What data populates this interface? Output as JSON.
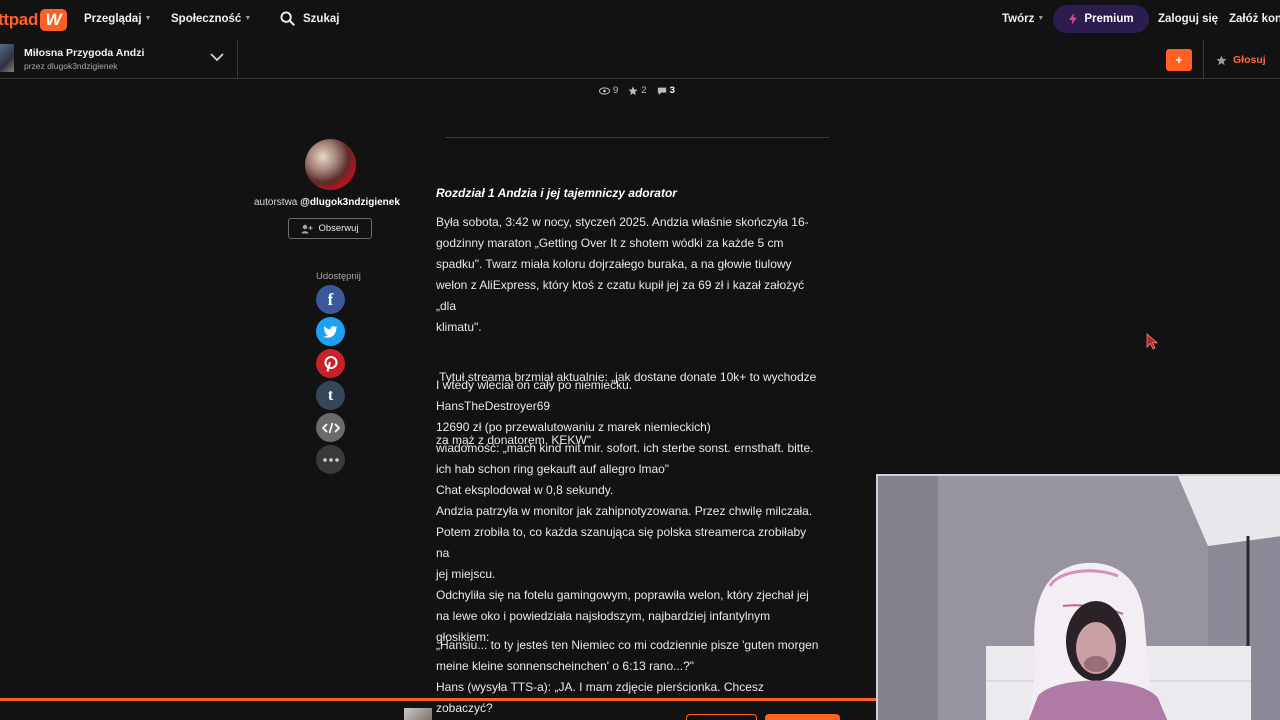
{
  "nav": {
    "logo_text": "ttpad",
    "logo_mark": "W",
    "browse": "Przeglądaj",
    "community": "Społeczność",
    "search": "Szukaj",
    "write": "Twórz",
    "premium": "Premium",
    "login": "Zaloguj się",
    "signup": "Załóż kont"
  },
  "story": {
    "title": "Miłosna Przygoda Andzi",
    "author": "przez dlugok3ndzigienek",
    "add_button": "+",
    "vote": "Głosuj"
  },
  "stats": {
    "views": "9",
    "votes": "2",
    "comments": "3"
  },
  "author_panel": {
    "by": "autorstwa",
    "handle": "@dlugok3ndzigienek",
    "follow": "Obserwuj",
    "share": "Udostępnij"
  },
  "share_icons": [
    "facebook-icon",
    "twitter-icon",
    "pinterest-icon",
    "tumblr-icon",
    "embed-icon",
    "more-icon"
  ],
  "chapter": {
    "title": "Rozdział 1 Andzia i jej tajemniczy adorator",
    "paragraphs": [
      [
        "Była sobota, 3:42 w nocy, styczeń 2025. Andzia właśnie skończyła 16-",
        "godzinny maraton „Getting Over It z shotem wódki za każde 5 cm",
        "spadku\". Twarz miała koloru dojrzałego buraka, a na głowie tiulowy",
        "welon z AliExpress, który ktoś z czatu kupił jej za 69 zł i kazał założyć „dla",
        "klimatu\"."
      ],
      [
        " Tytuł streama brzmiał aktualnie: „jak dostane donate 10k+ to wychodze",
        "za mąż z donatorem. KEKW\""
      ],
      [
        "I wtedy wleciał on cały po niemiecku.",
        "HansTheDestroyer69",
        "12690 zł (po przewalutowaniu z marek niemieckich)",
        "wiadomość: „mach kind mit mir. sofort. ich sterbe sonst. ernsthaft. bitte.",
        "ich hab schon ring gekauft auf allegro lmao\"",
        "Chat eksplodował w 0,8 sekundy.",
        "Andzia patrzyła w monitor jak zahipnotyzowana. Przez chwilę milczała.",
        "Potem zrobiła to, co każda szanująca się polska streamerca zrobiłaby na",
        "jej miejscu.",
        "Odchyliła się na fotelu gamingowym, poprawiła welon, który zjechał jej",
        "na lewe oko i powiedziała najsłodszym, najbardziej infantylnym",
        "głosikiem:"
      ],
      [
        "„Hansiu... to ty jesteś ten Niemiec co mi codziennie pisze 'guten morgen",
        "meine kleine sonnenscheinchen' o 6:13 rano...?\"",
        "Hans (wysyła TTS-a): „JA. I mam zdjęcie pierścionka. Chcesz zobaczyć?"
      ]
    ]
  },
  "colors": {
    "accent": "#ff6122",
    "premium_bg": "#2b1d4d",
    "background": "#121212"
  }
}
